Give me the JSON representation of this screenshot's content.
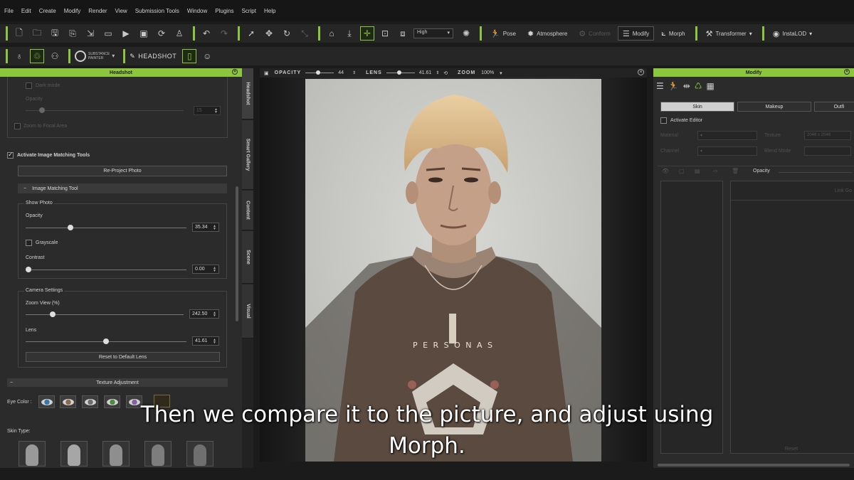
{
  "menu": [
    "File",
    "Edit",
    "Create",
    "Modify",
    "Render",
    "View",
    "Submission Tools",
    "Window",
    "Plugins",
    "Script",
    "Help"
  ],
  "toolbar1": {
    "quality_select": "High",
    "pose_label": "Pose",
    "atmosphere_label": "Atmosphere",
    "conform_label": "Conform",
    "modify_label": "Modify",
    "morph_label": "Morph",
    "transformer_label": "Transformer",
    "instalod_label": "InstaLOD"
  },
  "toolbar2": {
    "substance_line1": "SUBSTANCE",
    "substance_line2": "PAINTER",
    "headshot_label": "HEADSHOT"
  },
  "left_panel": {
    "title": "Headshot",
    "dark_mode_label": "Dark mode",
    "opacity_dim_label": "Opacity",
    "opacity_dim_value": "15",
    "zoom_to_focus_label": "Zoom to Focal Area",
    "activate_label": "Activate Image Matching Tools",
    "reproject_label": "Re-Project Photo",
    "imt_section": "Image Matching Tool",
    "show_photo_label": "Show Photo",
    "opacity_label": "Opacity",
    "opacity_value": "35.34",
    "opacity_fraction": 0.28,
    "grayscale_label": "Grayscale",
    "contrast_label": "Contrast",
    "contrast_value": "0.00",
    "contrast_fraction": 0.0,
    "camera_settings_label": "Camera Settings",
    "zoom_view_label": "Zoom View (%)",
    "zoom_view_value": "242.50",
    "zoom_fraction": 0.17,
    "lens_label": "Lens",
    "lens_value": "41.61",
    "lens_fraction": 0.5,
    "reset_lens_label": "Reset to Default Lens",
    "texture_adjustment_label": "Texture Adjustment",
    "eye_color_label": "Eye Color :",
    "eye_colors": [
      "#3b78a8",
      "#8a6a4a",
      "#6f6f6f",
      "#4f8a45",
      "#8a5fa5"
    ],
    "selected_eye_color": "#2f2a1c",
    "skin_type_label": "Skin Type:"
  },
  "side_tabs": [
    "Headshot",
    "Smart Gallery",
    "Content",
    "Scene",
    "Visual"
  ],
  "viewport": {
    "opacity_label": "OPACITY",
    "opacity_value": "44",
    "opacity_fraction": 0.44,
    "lens_label": "LENS",
    "lens_value": "41.61",
    "lens_fraction": 0.45,
    "zoom_label": "ZOOM",
    "zoom_value": "100%",
    "shirt_text": "P E R S O N A S"
  },
  "right_panel": {
    "title": "Modify",
    "tabs": [
      "Skin",
      "Makeup",
      "Outfi"
    ],
    "activate_editor_label": "Activate Editor",
    "material_label": "Material",
    "texture_label": "Texture",
    "texture_value": "2048 x 2048",
    "channel_label": "Channel",
    "blend_mode_label": "Blend Mode",
    "opacity_label": "Opacity",
    "link_label": "Link Go",
    "reset_label": "Reset"
  },
  "subtitle": {
    "line1": "Then we compare it to the picture, and adjust using",
    "line2": "Morph."
  },
  "colors": {
    "accent": "#8cc63f",
    "background": "#1b1b1b",
    "panel": "#2b2b2b"
  }
}
